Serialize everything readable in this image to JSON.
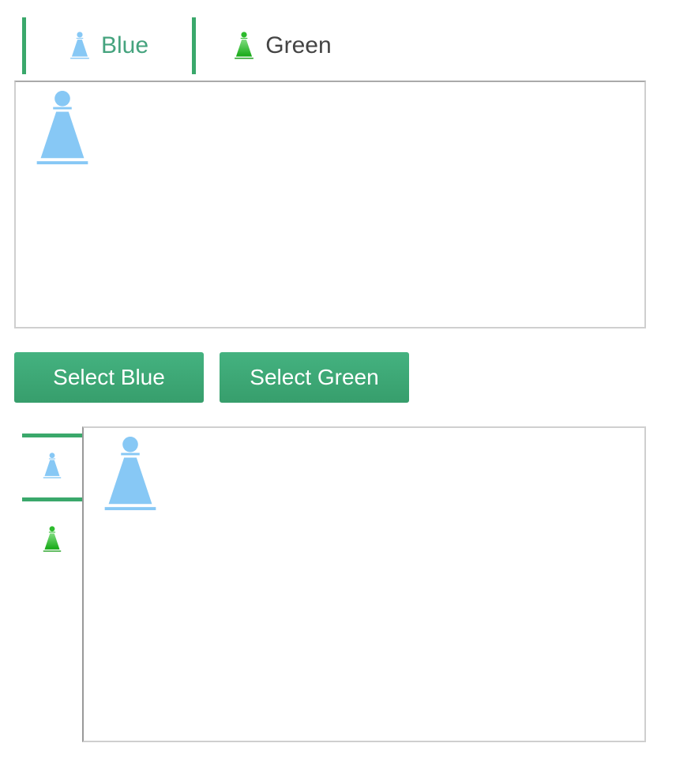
{
  "tabs_horizontal": {
    "items": [
      {
        "label": "Blue",
        "icon": "blue-pawn-icon",
        "color": "#87c8f5",
        "active": true
      },
      {
        "label": "Green",
        "icon": "green-pawn-icon",
        "color": "#2dbb2d",
        "active": false
      }
    ],
    "active_color": "#3aa86b"
  },
  "panel_top": {
    "content_icon": "blue-pawn-icon"
  },
  "buttons": {
    "select_blue_label": "Select Blue",
    "select_green_label": "Select Green",
    "color": "#3ea775"
  },
  "tabs_vertical": {
    "items": [
      {
        "icon": "blue-pawn-icon",
        "active": true
      },
      {
        "icon": "green-pawn-icon",
        "active": false
      }
    ]
  },
  "panel_bottom": {
    "content_icon": "blue-pawn-icon"
  }
}
